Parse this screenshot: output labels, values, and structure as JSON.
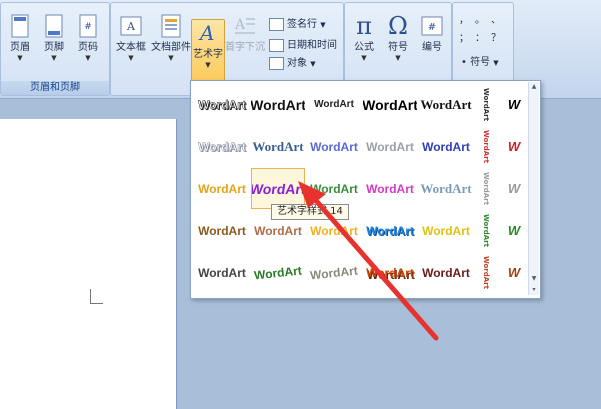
{
  "ribbon": {
    "header_footer": {
      "label": "页眉和页脚",
      "buttons": [
        "页眉",
        "页脚",
        "页码"
      ]
    },
    "text_group": {
      "buttons": [
        "文本框",
        "文档部件",
        "艺术字",
        "首字下沉"
      ],
      "small_items": [
        "签名行",
        "日期和时间",
        "对象"
      ]
    },
    "symbols_group": {
      "buttons": [
        "公式",
        "符号",
        "编号"
      ]
    },
    "special": {
      "symbol_label": "符号",
      "punct": [
        "，",
        "。",
        "、",
        "；",
        "：",
        "？"
      ]
    }
  },
  "gallery": {
    "sample_text": "WordArt",
    "tooltip": "艺术字样式 14",
    "styles": [
      {
        "color": "#222222",
        "style": "outline-plain"
      },
      {
        "color": "#111111",
        "style": "arch-bold"
      },
      {
        "color": "#222222",
        "style": "small-arch"
      },
      {
        "color": "#000000",
        "style": "black-bold"
      },
      {
        "color": "#111111",
        "style": "serif-plain"
      },
      {
        "color": "#8a8fa3",
        "style": "shadow-outline"
      },
      {
        "color": "#3a5d8f",
        "style": "blue-plain"
      },
      {
        "color": "#5a6ad0",
        "style": "purple-gradient"
      },
      {
        "color": "#9aa0aa",
        "style": "silver"
      },
      {
        "color": "#2d3fb8",
        "style": "blue-bold"
      },
      {
        "color": "#e8a21a",
        "style": "orange-gold"
      },
      {
        "color": "#8a1fd6",
        "style": "purple-bold"
      },
      {
        "color": "#3c8c3c",
        "style": "green-shadow"
      },
      {
        "color": "#d23bc4",
        "style": "rainbow"
      },
      {
        "color": "#7a9ab8",
        "style": "pale-blue"
      },
      {
        "color": "#8c5a1e",
        "style": "brown-wood"
      },
      {
        "color": "#b06b4a",
        "style": "copper"
      },
      {
        "color": "#f0b020",
        "style": "fire"
      },
      {
        "color": "#2088e0",
        "style": "blue-wave"
      },
      {
        "color": "#e0c010",
        "style": "yellow-arc"
      },
      {
        "color": "#444444",
        "style": "gray-shadow"
      },
      {
        "color": "#2a7a2a",
        "style": "green-3d"
      },
      {
        "color": "#8a8a7a",
        "style": "stone-arch"
      },
      {
        "color": "#cc4400",
        "style": "red-3d"
      },
      {
        "color": "#6a1a1a",
        "style": "maroon-plain"
      }
    ],
    "vertical_col": [
      "#333333",
      "#cc3333",
      "#999999",
      "#2a8a2a",
      "#c04020"
    ],
    "w_col": [
      "#000000",
      "#cc2222",
      "#999999",
      "#2a8a2a",
      "#a04010"
    ]
  }
}
